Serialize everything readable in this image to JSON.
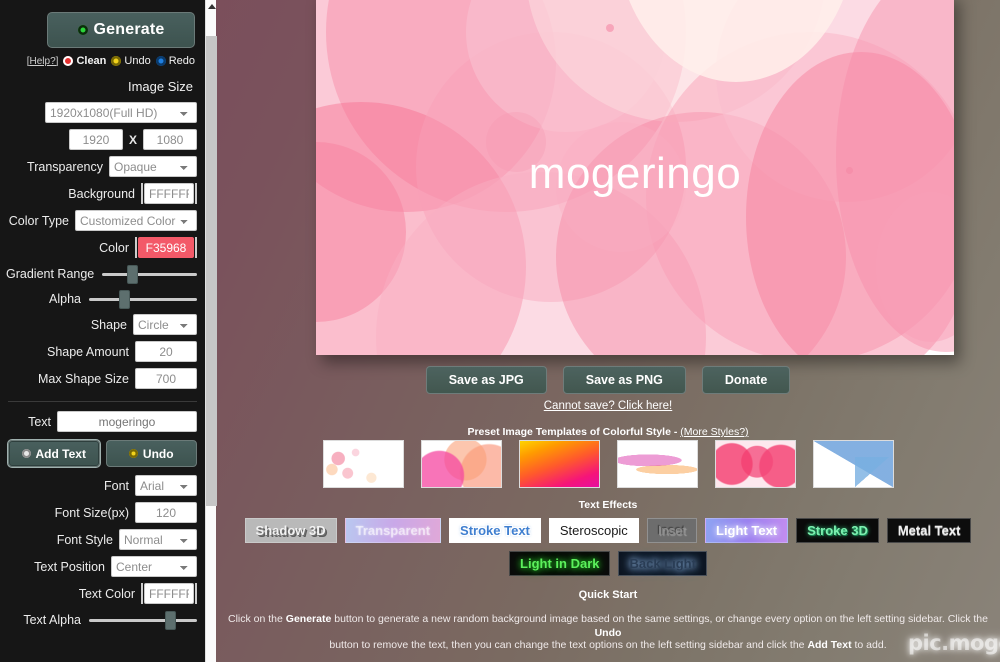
{
  "sidebar": {
    "generate_button": "Generate",
    "generate_icon": "record-circle-icon",
    "utilities": [
      {
        "label": "[Help?]",
        "icon": "help-link-icon"
      },
      {
        "label": "Clean",
        "icon": "red-x-circle-icon"
      },
      {
        "label": "Undo",
        "icon": "yellow-undo-circle-icon"
      },
      {
        "label": "Redo",
        "icon": "blue-redo-circle-icon"
      }
    ],
    "image_size": {
      "section_title": "Image Size",
      "preset": "1920x1080(Full HD)",
      "width": "1920",
      "separator": "X",
      "height": "1080"
    },
    "transparency": {
      "label": "Transparency",
      "value": "Opaque"
    },
    "background": {
      "label": "Background",
      "value": "FFFFFF"
    },
    "color_type": {
      "label": "Color Type",
      "value": "Customized Color"
    },
    "color": {
      "label": "Color",
      "value": "F35968",
      "swatch": "#f35968"
    },
    "gradient_range": {
      "label": "Gradient Range",
      "knob_percent": 30
    },
    "alpha": {
      "label": "Alpha",
      "knob_percent": 32
    },
    "shape": {
      "label": "Shape",
      "value": "Circle"
    },
    "shape_amount": {
      "label": "Shape Amount",
      "value": "20"
    },
    "max_shape_size": {
      "label": "Max Shape Size",
      "value": "700"
    },
    "text": {
      "label": "Text",
      "value": "mogeringo",
      "placeholder": "mogeringo"
    },
    "add_text_button": "Add Text",
    "undo_text_button": "Undo",
    "font": {
      "label": "Font",
      "value": "Arial"
    },
    "font_size": {
      "label": "Font Size(px)",
      "value": "120"
    },
    "font_style": {
      "label": "Font Style",
      "value": "Normal"
    },
    "text_position": {
      "label": "Text Position",
      "value": "Center"
    },
    "text_color": {
      "label": "Text Color",
      "value": "FFFFFF"
    },
    "text_alpha": {
      "label": "Text Alpha",
      "knob_percent": 72
    }
  },
  "canvas": {
    "overlay_text": "mogeringo"
  },
  "main": {
    "save_buttons": [
      {
        "label": "Save as JPG",
        "name": "save-as-jpg-button"
      },
      {
        "label": "Save as PNG",
        "name": "save-as-png-button"
      },
      {
        "label": "Donate",
        "name": "donate-button"
      }
    ],
    "cannot_save_link": "Cannot save? Click here!",
    "preset_title": "Preset Image Templates of Colorful Style",
    "preset_separator": " - ",
    "preset_more_link": "(More Styles?)",
    "preset_thumbnails": [
      "bokeh-dots-template",
      "pink-orange-blobs-template",
      "magenta-orange-gradient-template",
      "soft-ribbon-template",
      "red-circles-template",
      "blue-mountains-template"
    ],
    "text_effects_title": "Text Effects",
    "text_effects_row1": [
      "Shadow 3D",
      "Transparent",
      "Stroke Text",
      "Steroscopic",
      "Inset",
      "Light Text",
      "Stroke 3D",
      "Metal Text"
    ],
    "text_effects_row2": [
      "Light in Dark",
      "Back Light"
    ],
    "quick_start_title": "Quick Start",
    "quick_start_line1_a": "Click on the ",
    "quick_start_line1_b": "Generate",
    "quick_start_line1_c": " button to generate a new random background image based on the same settings, or change every option on the left setting sidebar. Click the ",
    "quick_start_line1_d": "Undo",
    "quick_start_line2_a": "button to remove the text, then you can change the text options on the left setting sidebar and click the ",
    "quick_start_line2_b": "Add Text",
    "quick_start_line2_c": " to add.",
    "watermark": "pic.mogeringo.com"
  },
  "scrollbar": {
    "name": "sidebar-scrollbar"
  }
}
